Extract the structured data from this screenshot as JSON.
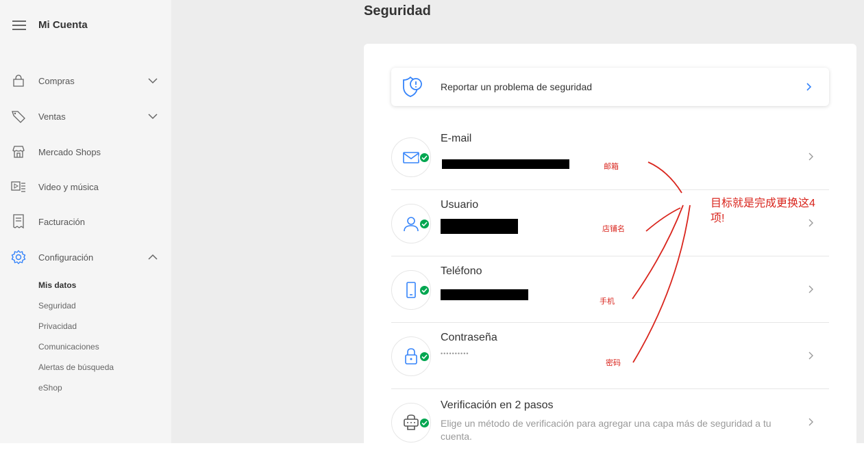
{
  "sidebar": {
    "title": "Mi Cuenta",
    "items": [
      {
        "label": "Compras",
        "icon": "bag-icon"
      },
      {
        "label": "Ventas",
        "icon": "tag-icon"
      },
      {
        "label": "Mercado Shops",
        "icon": "store-icon"
      },
      {
        "label": "Video y música",
        "icon": "media-icon"
      },
      {
        "label": "Facturación",
        "icon": "invoice-icon"
      },
      {
        "label": "Configuración",
        "icon": "gear-icon"
      }
    ],
    "sub_items": [
      "Mis datos",
      "Seguridad",
      "Privacidad",
      "Comunicaciones",
      "Alertas de búsqueda",
      "eShop"
    ]
  },
  "main": {
    "title": "Seguridad",
    "report_label": "Reportar un problema de seguridad",
    "rows": [
      {
        "title": "E-mail",
        "sub": "",
        "icon": "mail-icon"
      },
      {
        "title": "Usuario",
        "sub": "",
        "icon": "user-icon"
      },
      {
        "title": "Teléfono",
        "sub": "",
        "icon": "phone-icon"
      },
      {
        "title": "Contraseña",
        "sub": "••••••••••",
        "icon": "lock-icon"
      },
      {
        "title": "Verificación en 2 pasos",
        "sub": "Elige un método de verificación para agregar una capa más de seguridad a tu cuenta.",
        "icon": "two-step-icon"
      }
    ]
  },
  "annotations": {
    "email": "邮箱",
    "user": "店铺名",
    "phone": "手机",
    "password": "密码",
    "goal": "目标就是完成更换这4项!"
  },
  "colors": {
    "accent_blue": "#3483fa",
    "success_green": "#00a650",
    "annotation_red": "#d9251d"
  }
}
